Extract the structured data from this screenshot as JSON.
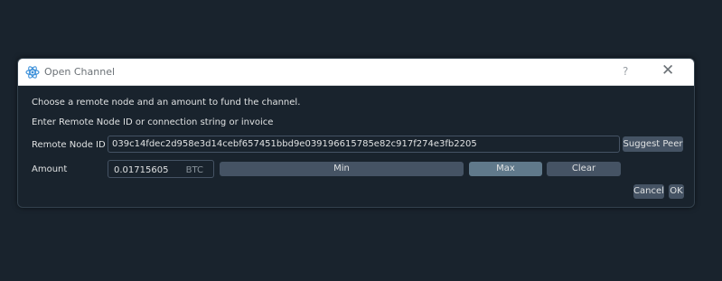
{
  "dialog": {
    "title": "Open Channel",
    "help_label": "?",
    "close_label": "✕",
    "instruction": "Choose a remote node and an amount to fund the channel.",
    "hint": "Enter Remote Node ID or connection string or invoice",
    "node_label": "Remote Node ID",
    "node_value": "039c14fdec2d958e3d14cebf657451bbd9e039196615785e82c917f274e3fb2205",
    "suggest_label": "Suggest Peer",
    "amount_label": "Amount",
    "amount_value": "0.01715605",
    "amount_unit": "BTC",
    "min_label": "Min",
    "max_label": "Max",
    "clear_label": "Clear",
    "cancel_label": "Cancel",
    "ok_label": "OK"
  },
  "colors": {
    "background": "#19232d",
    "titlebar": "#ffffff",
    "button": "#455364",
    "button_active": "#60798b",
    "app_icon": "#3a8fd9"
  },
  "icons": {
    "app": "electrum-atom-icon"
  }
}
